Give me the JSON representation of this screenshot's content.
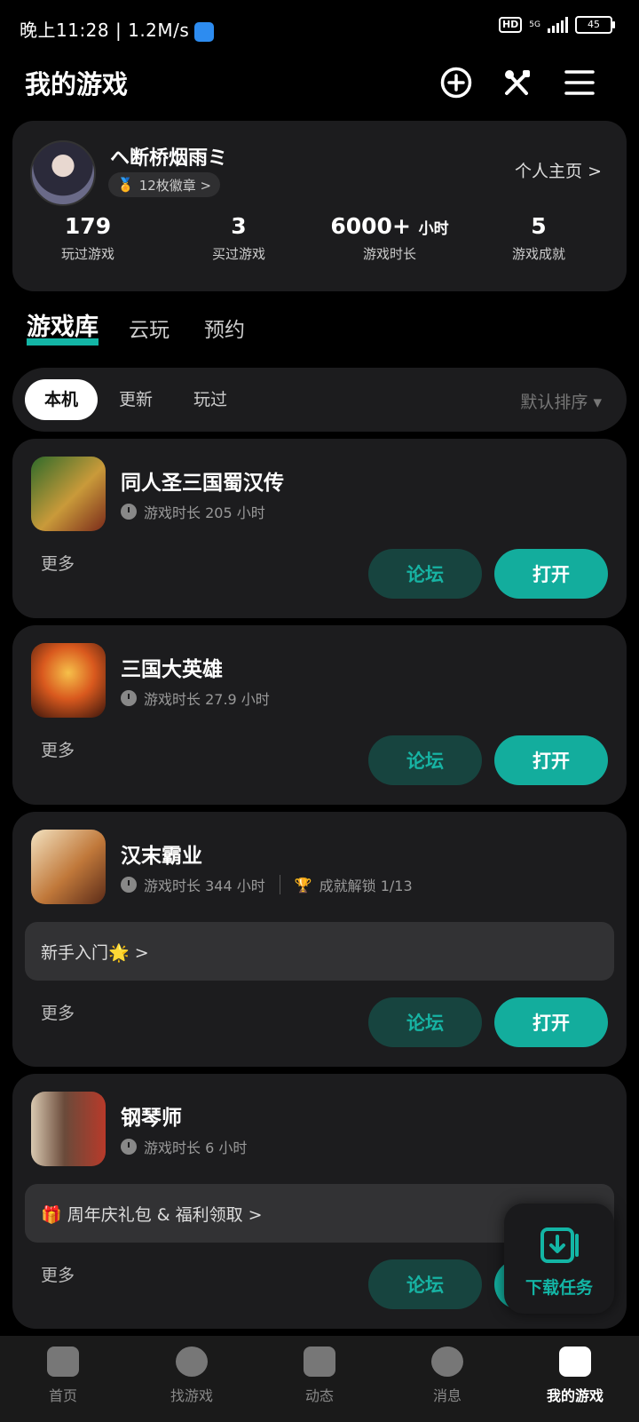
{
  "status_bar": {
    "time": "晚上11:28 | 1.2M/s",
    "hd": "HD",
    "network": "5G",
    "battery": "45"
  },
  "header": {
    "title": "我的游戏",
    "icons": [
      "add-circle-icon",
      "tools-icon",
      "menu-icon"
    ]
  },
  "profile": {
    "username": "ヘ断桥烟雨ミ",
    "badges": "12枚徽章 >",
    "home_link": "个人主页 >",
    "stats": [
      {
        "value": "179",
        "unit": "",
        "label": "玩过游戏"
      },
      {
        "value": "3",
        "unit": "",
        "label": "买过游戏"
      },
      {
        "value": "6000+",
        "unit": "小时",
        "label": "游戏时长"
      },
      {
        "value": "5",
        "unit": "",
        "label": "游戏成就"
      }
    ]
  },
  "tabs": [
    "游戏库",
    "云玩",
    "预约"
  ],
  "filters": {
    "chips": [
      "本机",
      "更新",
      "玩过"
    ],
    "sort": "默认排序 ▾"
  },
  "games": [
    {
      "name": "同人圣三国蜀汉传",
      "time": "游戏时长 205 小时",
      "achievement": "",
      "banner": "",
      "more": "更多",
      "forum": "论坛",
      "open": "打开"
    },
    {
      "name": "三国大英雄",
      "time": "游戏时长 27.9 小时",
      "achievement": "",
      "banner": "",
      "more": "更多",
      "forum": "论坛",
      "open": "打开"
    },
    {
      "name": "汉末霸业",
      "time": "游戏时长 344 小时",
      "achievement": "成就解锁 1/13",
      "banner": "新手入门🌟 >",
      "more": "更多",
      "forum": "论坛",
      "open": "打开"
    },
    {
      "name": "钢琴师",
      "time": "游戏时长 6 小时",
      "achievement": "",
      "banner": "🎁 周年庆礼包 & 福利领取 >",
      "more": "更多",
      "forum": "论坛",
      "open": "打开"
    }
  ],
  "download_task": {
    "label": "下载任务"
  },
  "bottom_nav": [
    {
      "label": "首页",
      "icon": "home-icon"
    },
    {
      "label": "找游戏",
      "icon": "planet-icon"
    },
    {
      "label": "动态",
      "icon": "feed-icon"
    },
    {
      "label": "消息",
      "icon": "chat-icon"
    },
    {
      "label": "我的游戏",
      "icon": "gamepad-icon"
    }
  ],
  "colors": {
    "accent": "#13ad9d",
    "forum_bg": "#17443f",
    "card_bg": "#1c1c1e"
  }
}
